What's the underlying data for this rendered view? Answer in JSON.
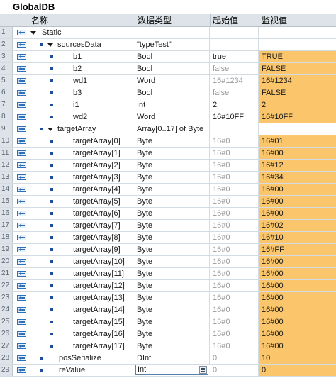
{
  "title": "GlobalDB",
  "headers": {
    "name": "名称",
    "type": "数据类型",
    "start": "起始值",
    "monitor": "监视值"
  },
  "rows": [
    {
      "num": "1",
      "name": "Static",
      "type": "",
      "start": "",
      "monitor": "",
      "level": 0,
      "expander": "down",
      "bullet": false,
      "icon": true,
      "orange": false,
      "grey": false
    },
    {
      "num": "2",
      "name": "sourcesData",
      "type": "\"typeTest\"",
      "start": "",
      "monitor": "",
      "level": 1,
      "expander": "down",
      "bullet": true,
      "icon": true,
      "orange": false,
      "grey": false
    },
    {
      "num": "3",
      "name": "b1",
      "type": "Bool",
      "start": "true",
      "monitor": "TRUE",
      "level": 2,
      "expander": "",
      "bullet": true,
      "icon": true,
      "orange": true,
      "grey": false
    },
    {
      "num": "4",
      "name": "b2",
      "type": "Bool",
      "start": "false",
      "monitor": "FALSE",
      "level": 2,
      "expander": "",
      "bullet": true,
      "icon": true,
      "orange": true,
      "grey": true
    },
    {
      "num": "5",
      "name": "wd1",
      "type": "Word",
      "start": "16#1234",
      "monitor": "16#1234",
      "level": 2,
      "expander": "",
      "bullet": true,
      "icon": true,
      "orange": true,
      "grey": true
    },
    {
      "num": "6",
      "name": "b3",
      "type": "Bool",
      "start": "false",
      "monitor": "FALSE",
      "level": 2,
      "expander": "",
      "bullet": true,
      "icon": true,
      "orange": true,
      "grey": true
    },
    {
      "num": "7",
      "name": "i1",
      "type": "Int",
      "start": "2",
      "monitor": "2",
      "level": 2,
      "expander": "",
      "bullet": true,
      "icon": true,
      "orange": true,
      "grey": false
    },
    {
      "num": "8",
      "name": "wd2",
      "type": "Word",
      "start": "16#10FF",
      "monitor": "16#10FF",
      "level": 2,
      "expander": "",
      "bullet": true,
      "icon": true,
      "orange": true,
      "grey": false
    },
    {
      "num": "9",
      "name": "targetArray",
      "type": "Array[0..17] of Byte",
      "start": "",
      "monitor": "",
      "level": 1,
      "expander": "down",
      "bullet": true,
      "icon": true,
      "orange": false,
      "grey": false
    },
    {
      "num": "10",
      "name": "targetArray[0]",
      "type": "Byte",
      "start": "16#0",
      "monitor": "16#01",
      "level": 2,
      "expander": "",
      "bullet": true,
      "icon": true,
      "orange": true,
      "grey": true
    },
    {
      "num": "11",
      "name": "targetArray[1]",
      "type": "Byte",
      "start": "16#0",
      "monitor": "16#00",
      "level": 2,
      "expander": "",
      "bullet": true,
      "icon": true,
      "orange": true,
      "grey": true
    },
    {
      "num": "12",
      "name": "targetArray[2]",
      "type": "Byte",
      "start": "16#0",
      "monitor": "16#12",
      "level": 2,
      "expander": "",
      "bullet": true,
      "icon": true,
      "orange": true,
      "grey": true
    },
    {
      "num": "13",
      "name": "targetArray[3]",
      "type": "Byte",
      "start": "16#0",
      "monitor": "16#34",
      "level": 2,
      "expander": "",
      "bullet": true,
      "icon": true,
      "orange": true,
      "grey": true
    },
    {
      "num": "14",
      "name": "targetArray[4]",
      "type": "Byte",
      "start": "16#0",
      "monitor": "16#00",
      "level": 2,
      "expander": "",
      "bullet": true,
      "icon": true,
      "orange": true,
      "grey": true
    },
    {
      "num": "15",
      "name": "targetArray[5]",
      "type": "Byte",
      "start": "16#0",
      "monitor": "16#00",
      "level": 2,
      "expander": "",
      "bullet": true,
      "icon": true,
      "orange": true,
      "grey": true
    },
    {
      "num": "16",
      "name": "targetArray[6]",
      "type": "Byte",
      "start": "16#0",
      "monitor": "16#00",
      "level": 2,
      "expander": "",
      "bullet": true,
      "icon": true,
      "orange": true,
      "grey": true
    },
    {
      "num": "17",
      "name": "targetArray[7]",
      "type": "Byte",
      "start": "16#0",
      "monitor": "16#02",
      "level": 2,
      "expander": "",
      "bullet": true,
      "icon": true,
      "orange": true,
      "grey": true
    },
    {
      "num": "18",
      "name": "targetArray[8]",
      "type": "Byte",
      "start": "16#0",
      "monitor": "16#10",
      "level": 2,
      "expander": "",
      "bullet": true,
      "icon": true,
      "orange": true,
      "grey": true
    },
    {
      "num": "19",
      "name": "targetArray[9]",
      "type": "Byte",
      "start": "16#0",
      "monitor": "16#FF",
      "level": 2,
      "expander": "",
      "bullet": true,
      "icon": true,
      "orange": true,
      "grey": true
    },
    {
      "num": "20",
      "name": "targetArray[10]",
      "type": "Byte",
      "start": "16#0",
      "monitor": "16#00",
      "level": 2,
      "expander": "",
      "bullet": true,
      "icon": true,
      "orange": true,
      "grey": true
    },
    {
      "num": "21",
      "name": "targetArray[11]",
      "type": "Byte",
      "start": "16#0",
      "monitor": "16#00",
      "level": 2,
      "expander": "",
      "bullet": true,
      "icon": true,
      "orange": true,
      "grey": true
    },
    {
      "num": "22",
      "name": "targetArray[12]",
      "type": "Byte",
      "start": "16#0",
      "monitor": "16#00",
      "level": 2,
      "expander": "",
      "bullet": true,
      "icon": true,
      "orange": true,
      "grey": true
    },
    {
      "num": "23",
      "name": "targetArray[13]",
      "type": "Byte",
      "start": "16#0",
      "monitor": "16#00",
      "level": 2,
      "expander": "",
      "bullet": true,
      "icon": true,
      "orange": true,
      "grey": true
    },
    {
      "num": "24",
      "name": "targetArray[14]",
      "type": "Byte",
      "start": "16#0",
      "monitor": "16#00",
      "level": 2,
      "expander": "",
      "bullet": true,
      "icon": true,
      "orange": true,
      "grey": true
    },
    {
      "num": "25",
      "name": "targetArray[15]",
      "type": "Byte",
      "start": "16#0",
      "monitor": "16#00",
      "level": 2,
      "expander": "",
      "bullet": true,
      "icon": true,
      "orange": true,
      "grey": true
    },
    {
      "num": "26",
      "name": "targetArray[16]",
      "type": "Byte",
      "start": "16#0",
      "monitor": "16#00",
      "level": 2,
      "expander": "",
      "bullet": true,
      "icon": true,
      "orange": true,
      "grey": true
    },
    {
      "num": "27",
      "name": "targetArray[17]",
      "type": "Byte",
      "start": "16#0",
      "monitor": "16#00",
      "level": 2,
      "expander": "",
      "bullet": true,
      "icon": true,
      "orange": true,
      "grey": true
    },
    {
      "num": "28",
      "name": "posSerialize",
      "type": "DInt",
      "start": "0",
      "monitor": "10",
      "level": 1,
      "expander": "",
      "bullet": true,
      "icon": true,
      "orange": true,
      "grey": true
    },
    {
      "num": "29",
      "name": "reValue",
      "type": "Int",
      "start": "0",
      "monitor": "0",
      "level": 1,
      "expander": "",
      "bullet": true,
      "icon": true,
      "orange": true,
      "grey": true,
      "editing": true
    }
  ],
  "colors": {
    "monitor_bg": "#fbc66b",
    "header_bg": "#dde3e8",
    "icon_blue": "#2d6fb8"
  }
}
